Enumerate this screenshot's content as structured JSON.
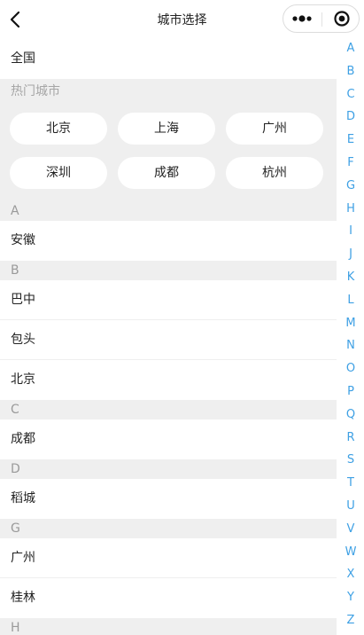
{
  "navbar": {
    "title": "城市选择",
    "back_icon": "chevron-left-icon",
    "more_icon": "more-dots-icon",
    "close_icon": "target-close-icon"
  },
  "country_row": "全国",
  "hot": {
    "title": "热门城市",
    "cities": [
      "北京",
      "上海",
      "广州",
      "深圳",
      "成都",
      "杭州"
    ]
  },
  "groups": [
    {
      "letter": "A",
      "cities": [
        "安徽"
      ]
    },
    {
      "letter": "B",
      "cities": [
        "巴中",
        "包头",
        "北京"
      ]
    },
    {
      "letter": "C",
      "cities": [
        "成都"
      ]
    },
    {
      "letter": "D",
      "cities": [
        "稻城"
      ]
    },
    {
      "letter": "G",
      "cities": [
        "广州",
        "桂林"
      ]
    },
    {
      "letter": "H",
      "cities": []
    }
  ],
  "index_letters": [
    "A",
    "B",
    "C",
    "D",
    "E",
    "F",
    "G",
    "H",
    "I",
    "J",
    "K",
    "L",
    "M",
    "N",
    "O",
    "P",
    "Q",
    "R",
    "S",
    "T",
    "U",
    "V",
    "W",
    "X",
    "Y",
    "Z"
  ],
  "colors": {
    "index_accent": "#3ea0e4",
    "section_bg": "#efefef",
    "section_text": "#9a9a9a"
  }
}
